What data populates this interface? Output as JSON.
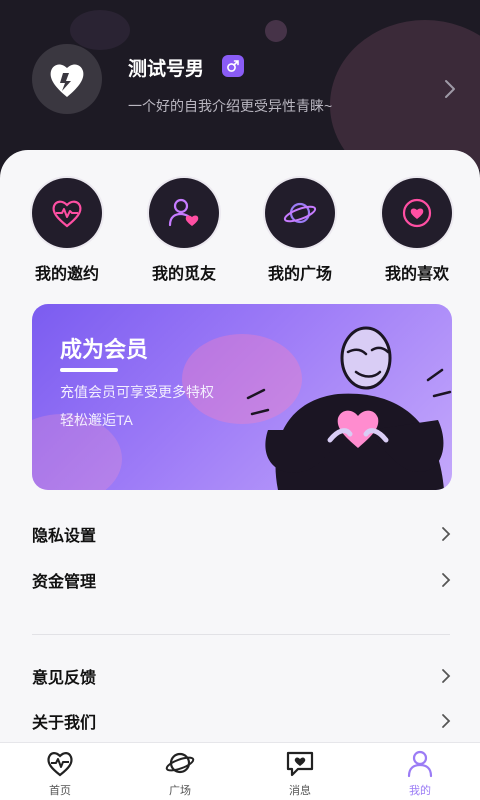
{
  "profile": {
    "name": "测试号男",
    "bio": "一个好的自我介绍更受异性青睐~"
  },
  "quick_menu": [
    {
      "label": "我的邀约",
      "icon": "heart-pulse-icon"
    },
    {
      "label": "我的觅友",
      "icon": "user-heart-icon"
    },
    {
      "label": "我的广场",
      "icon": "planet-icon"
    },
    {
      "label": "我的喜欢",
      "icon": "heart-circle-icon"
    }
  ],
  "vip_banner": {
    "title": "成为会员",
    "line1": "充值会员可享受更多特权",
    "line2": "轻松邂逅TA"
  },
  "settings": [
    {
      "label": "隐私设置"
    },
    {
      "label": "资金管理"
    },
    {
      "label": "意见反馈"
    },
    {
      "label": "关于我们"
    }
  ],
  "tabbar": [
    {
      "label": "首页",
      "icon": "home-heartbeat-icon"
    },
    {
      "label": "广场",
      "icon": "planet-icon"
    },
    {
      "label": "消息",
      "icon": "message-heart-icon"
    },
    {
      "label": "我的",
      "icon": "profile-icon"
    }
  ],
  "colors": {
    "accent": "#8a5cf6",
    "neon_pink": "#ff4fa3",
    "dark": "#1d1a24"
  }
}
